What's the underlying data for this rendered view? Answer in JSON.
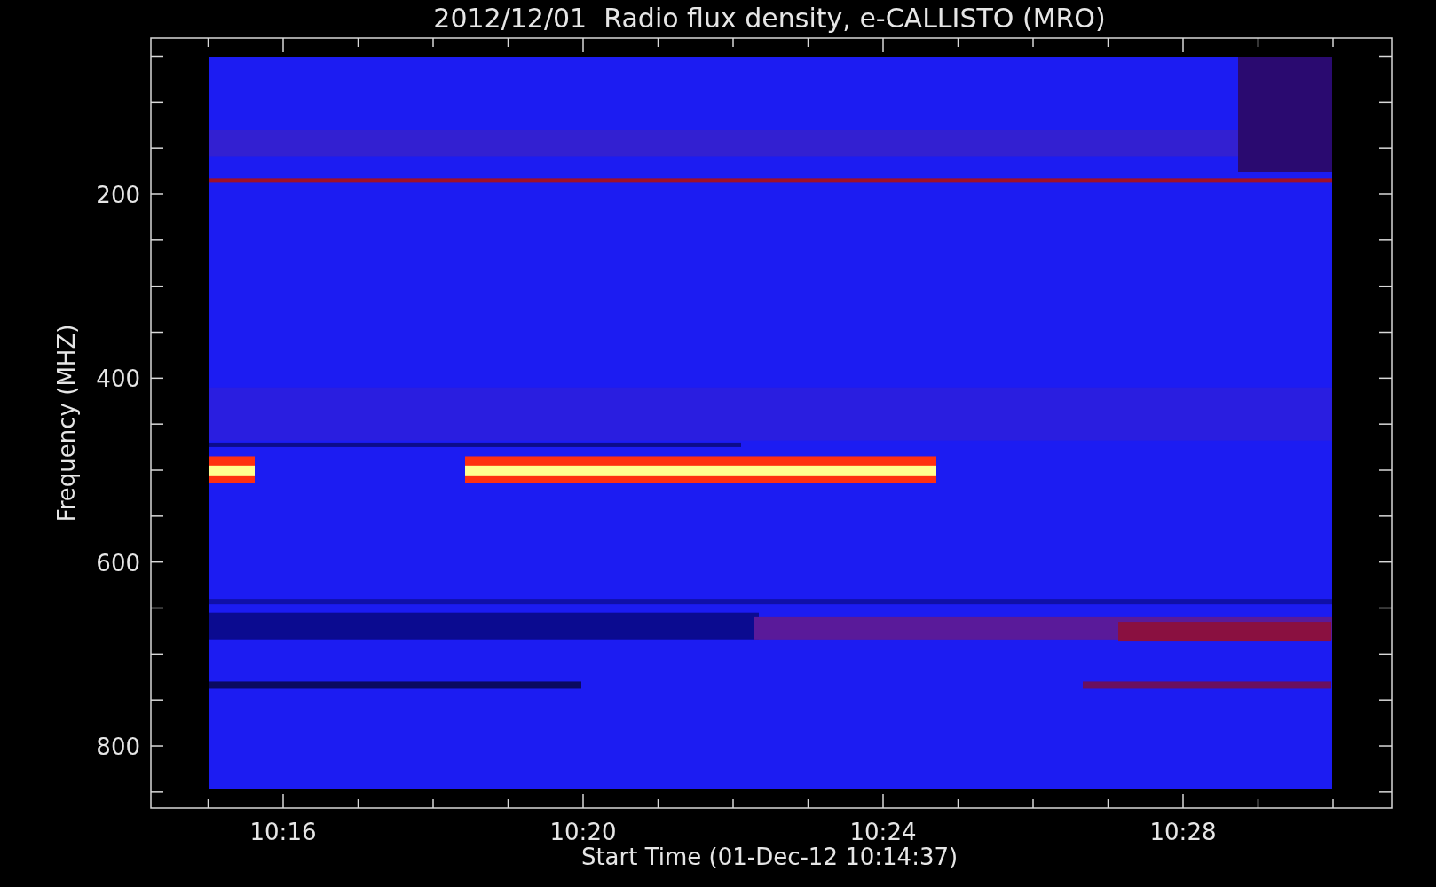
{
  "title": "2012/12/01  Radio flux density, e-CALLISTO (MRO)",
  "y_axis": {
    "label": "Frequency (MHZ)",
    "ticks": [
      "200",
      "400",
      "600",
      "800"
    ]
  },
  "x_axis": {
    "label": "Start Time (01-Dec-12 10:14:37)",
    "ticks": [
      "10:16",
      "10:20",
      "10:24",
      "10:28"
    ]
  }
}
